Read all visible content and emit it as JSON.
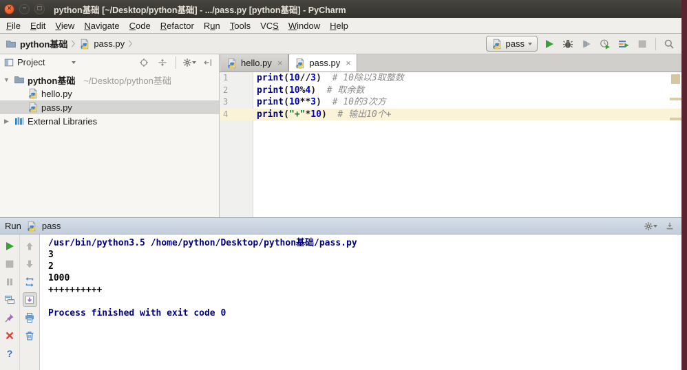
{
  "window": {
    "title": "python基础 [~/Desktop/python基础] - .../pass.py [python基础] - PyCharm",
    "buttons": [
      "close",
      "minimize",
      "maximize"
    ]
  },
  "menubar": {
    "items": [
      {
        "label": "File",
        "m": 0
      },
      {
        "label": "Edit",
        "m": 0
      },
      {
        "label": "View",
        "m": 0
      },
      {
        "label": "Navigate",
        "m": 0
      },
      {
        "label": "Code",
        "m": 0
      },
      {
        "label": "Refactor",
        "m": 0
      },
      {
        "label": "Run",
        "m": 1
      },
      {
        "label": "Tools",
        "m": 0
      },
      {
        "label": "VCS",
        "m": 2
      },
      {
        "label": "Window",
        "m": 0
      },
      {
        "label": "Help",
        "m": 0
      }
    ]
  },
  "breadcrumbs": {
    "items": [
      {
        "icon": "folder",
        "label": "python基础",
        "bold": true
      },
      {
        "icon": "python",
        "label": "pass.py",
        "bold": false
      }
    ]
  },
  "toolbar": {
    "run_config": "pass",
    "buttons": [
      "run",
      "debug",
      "coverage",
      "profiler",
      "run-with-settings",
      "stop",
      "search"
    ]
  },
  "project_panel": {
    "title": "Project",
    "header_icons": [
      "locate",
      "collapse-all",
      "settings",
      "hide"
    ],
    "tree": [
      {
        "arrow": "down",
        "icon": "folder",
        "label": "python基础",
        "path": "~/Desktop/python基础",
        "bold": true,
        "indent": 0,
        "selected": false
      },
      {
        "icon": "python",
        "label": "hello.py",
        "indent": 1,
        "selected": false
      },
      {
        "icon": "python",
        "label": "pass.py",
        "indent": 1,
        "selected": true
      },
      {
        "arrow": "right",
        "icon": "library",
        "label": "External Libraries",
        "indent": 0,
        "selected": false
      }
    ]
  },
  "editor": {
    "tabs": [
      {
        "icon": "python",
        "label": "hello.py",
        "active": false
      },
      {
        "icon": "python",
        "label": "pass.py",
        "active": true
      }
    ],
    "lines": [
      {
        "num": "1",
        "current": false,
        "segments": [
          {
            "t": "print",
            "c": "kw"
          },
          {
            "t": "(",
            "c": "pl"
          },
          {
            "t": "10",
            "c": "num"
          },
          {
            "t": "//",
            "c": "op"
          },
          {
            "t": "3",
            "c": "num"
          },
          {
            "t": ")",
            "c": "pl"
          },
          {
            "t": "  ",
            "c": "pl"
          },
          {
            "t": "# 10除以3取整数",
            "c": "cm"
          }
        ]
      },
      {
        "num": "2",
        "current": false,
        "segments": [
          {
            "t": "print",
            "c": "kw"
          },
          {
            "t": "(",
            "c": "pl"
          },
          {
            "t": "10",
            "c": "num"
          },
          {
            "t": "%",
            "c": "op"
          },
          {
            "t": "4",
            "c": "num"
          },
          {
            "t": ")",
            "c": "pl"
          },
          {
            "t": "  ",
            "c": "pl"
          },
          {
            "t": "# 取余数",
            "c": "cm"
          }
        ]
      },
      {
        "num": "3",
        "current": false,
        "segments": [
          {
            "t": "print",
            "c": "kw"
          },
          {
            "t": "(",
            "c": "pl"
          },
          {
            "t": "10",
            "c": "num"
          },
          {
            "t": "**",
            "c": "op"
          },
          {
            "t": "3",
            "c": "num"
          },
          {
            "t": ")",
            "c": "pl"
          },
          {
            "t": "  ",
            "c": "pl"
          },
          {
            "t": "# 10的3次方",
            "c": "cm"
          }
        ]
      },
      {
        "num": "4",
        "current": true,
        "segments": [
          {
            "t": "print",
            "c": "kw"
          },
          {
            "t": "(",
            "c": "pl"
          },
          {
            "t": "\"+\"",
            "c": "str"
          },
          {
            "t": "*",
            "c": "op"
          },
          {
            "t": "10",
            "c": "num"
          },
          {
            "t": ")",
            "c": "pl"
          },
          {
            "t": "  ",
            "c": "pl"
          },
          {
            "t": "# 输出10个+",
            "c": "cm"
          }
        ]
      }
    ]
  },
  "run_panel": {
    "label": "Run",
    "session": {
      "icon": "python",
      "label": "pass"
    },
    "left_toolbar": [
      "rerun",
      "stop",
      "pause",
      "show-processes",
      "pin",
      "close",
      "help"
    ],
    "second_toolbar": [
      "up",
      "down",
      "restore-layout",
      "scroll-to-end",
      "print",
      "clear"
    ],
    "header_icons": [
      "settings",
      "dock"
    ],
    "console": [
      {
        "type": "system",
        "text": "/usr/bin/python3.5 /home/python/Desktop/python基础/pass.py"
      },
      {
        "type": "stdout",
        "text": "3"
      },
      {
        "type": "stdout",
        "text": "2"
      },
      {
        "type": "stdout",
        "text": "1000"
      },
      {
        "type": "stdout",
        "text": "++++++++++"
      },
      {
        "type": "stdout",
        "text": ""
      },
      {
        "type": "system",
        "text": "Process finished with exit code 0"
      }
    ]
  },
  "colors": {
    "run_green": "#3ba037",
    "console_system": "#000080",
    "current_line": "#faf3d8",
    "desktop_edge": "#5a2531",
    "run_header_bg": "#ccd6e1",
    "selected_row": "#d5d5d4"
  }
}
